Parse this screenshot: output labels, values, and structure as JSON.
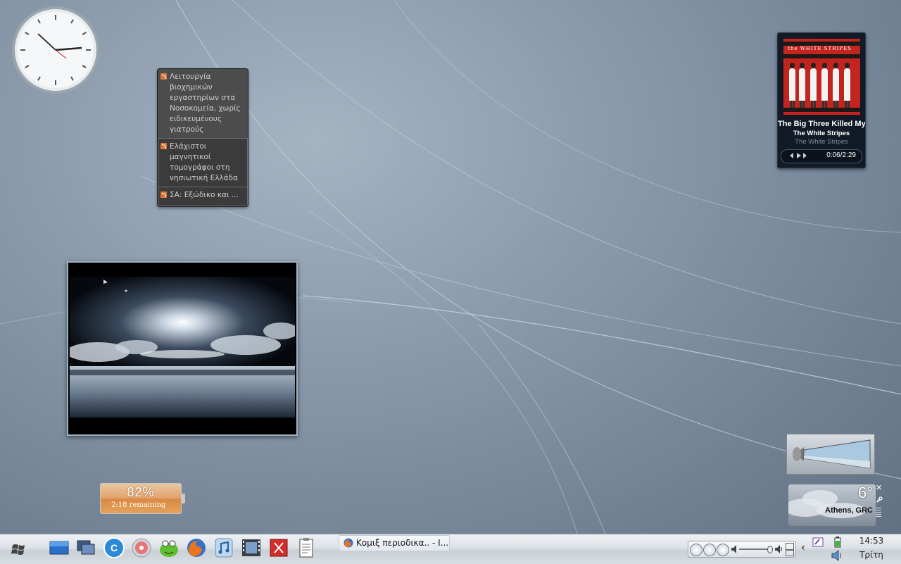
{
  "feeds": {
    "items": [
      {
        "title": "Λειτουργία βιοχημικών εργαστηρίων στα Νοσοκομεία, χωρίς ειδικευμένους γιατρούς"
      },
      {
        "title": "Ελάχιστοι μαγνητικοί τομογράφοι στη νησιωτική Ελλάδα"
      },
      {
        "title": "ΣΑ: Εξώδικο και ..."
      }
    ]
  },
  "player": {
    "song": "The Big Three Killed My",
    "artist": "The White Stripes",
    "album": "The White Stripes",
    "time": "0:06/2:29",
    "album_art_text": "the WHITE STRIPES"
  },
  "battery": {
    "percent_label": "82%",
    "percent": 82,
    "remaining": "2:18 remaining"
  },
  "weather": {
    "temperature": "6°",
    "location": "Athens, GRC"
  },
  "taskbar": {
    "window_button": "Κομιξ περιοδικα.. - I...",
    "time": "14:53",
    "day": "Τρίτη",
    "quick_launch": [
      "show-desktop-icon",
      "switch-windows-icon",
      "ccleaner-icon",
      "cd-burner-icon",
      "frog-app-icon",
      "firefox-icon",
      "itunes-icon",
      "movie-maker-icon",
      "acrobat-icon",
      "clipboard-icon"
    ]
  },
  "colors": {
    "desktop": "#8b9bac",
    "album_red": "#c4241e",
    "battery_orange": "#d98942"
  }
}
